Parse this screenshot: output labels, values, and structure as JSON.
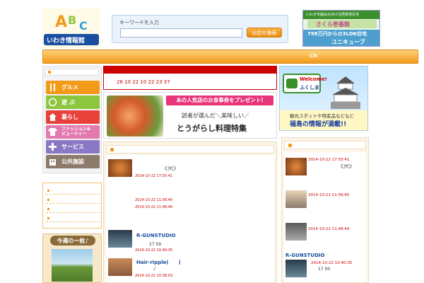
{
  "header": {
    "logo": {
      "letters": "ABC",
      "text": "いわき情報館"
    },
    "search": {
      "label": "キーワードを入力",
      "placeholder": "",
      "button": "お店を検索"
    },
    "banner": {
      "line1": "いわき市議会お向け住居賃貸住宅",
      "line2": "さくら壱番館",
      "line3": "798万円からの3LDK住宅",
      "line4": "ユニキューブ"
    }
  },
  "nav": {
    "cn_label": "CN"
  },
  "sidebar": {
    "menu": [
      {
        "label": "グルメ",
        "icon": "fork-knife-icon",
        "color": "#f39a18"
      },
      {
        "label": "遊 ぶ",
        "icon": "tennis-icon",
        "color": "#8cc63f"
      },
      {
        "label": "暮らし",
        "icon": "house-icon",
        "color": "#e8413c"
      },
      {
        "label": "ファッション&\nビューティー",
        "icon": "shirt-icon",
        "color": "#e27ab0"
      },
      {
        "label": "サービス",
        "icon": "cross-icon",
        "color": "#8b78c4"
      },
      {
        "label": "公共施設",
        "icon": "building-icon",
        "color": "#8c7a6b"
      }
    ],
    "photo_title": "今週の一枚♪"
  },
  "date_box": {
    "dates": "26 10 22  10 22  23 37"
  },
  "promo": {
    "pill": "あの人気店のお食事券をプレゼント!",
    "line2": "読者が選んだ＼美味しい／",
    "line3": "とうがらし料理特集"
  },
  "right_banner": {
    "welcome": "Welcome!",
    "welcome2": "ふくしま",
    "line1": "観光スポットや特産品などなど",
    "line2": "福島の情報が満載!!"
  },
  "feed_left": [
    {
      "title": "",
      "sub": "(ﾟ∀ﾟ)",
      "time": "2014-10-22 17:55:41"
    },
    {
      "title": "",
      "sub": "",
      "time": "2014-10-22 11:56:40"
    },
    {
      "title": "",
      "sub": "",
      "time": "2014-10-22 11:48:49"
    },
    {
      "title": "R-GUNSTUDIO",
      "sub": "17 00",
      "time": "2014-10-22 10:40:35"
    },
    {
      "title": "Hair-ripple(　　)",
      "sub": "♪",
      "time": "2014-10-22 10:38:03"
    }
  ],
  "feed_right": [
    {
      "title": "",
      "sub": "(ﾟ∀ﾟ)",
      "time": "2014-10-22 17:55:41"
    },
    {
      "title": "",
      "sub": "",
      "time": "2014-10-22 11:56:40"
    },
    {
      "title": "",
      "sub": "",
      "time": "2014-10-22 11:48:49"
    },
    {
      "title": "R-GUNSTUDIO",
      "sub": "17 00",
      "time": "2014-10-22 10:40:35"
    }
  ]
}
